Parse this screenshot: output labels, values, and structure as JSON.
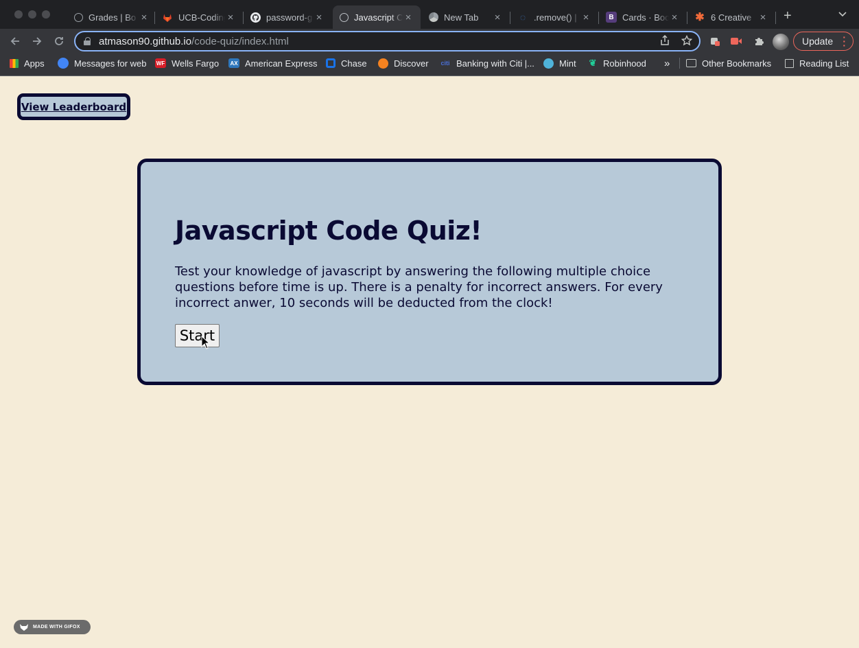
{
  "tabs": [
    {
      "title": "Grades | Bo",
      "icon": "globe-icon"
    },
    {
      "title": "UCB-Coding",
      "icon": "gitlab-icon"
    },
    {
      "title": "password-g",
      "icon": "github-icon"
    },
    {
      "title": "Javascript C",
      "icon": "globe-icon",
      "active": true
    },
    {
      "title": "New Tab",
      "icon": "chrome-icon"
    },
    {
      "title": ".remove() |",
      "icon": "jquery-icon"
    },
    {
      "title": "Cards · Boo",
      "icon": "bootstrap-icon"
    },
    {
      "title": "6 Creative",
      "icon": "asterisk-icon"
    }
  ],
  "tab_close_glyph": "×",
  "new_tab_glyph": "+",
  "address": {
    "host": "atmason90.github.io",
    "path": "/code-quiz/index.html"
  },
  "toolbar": {
    "update_label": "Update"
  },
  "bookmarks": [
    {
      "label": "Apps",
      "icon": "apps-grid-icon"
    },
    {
      "label": "Messages for web",
      "icon": "messages-icon"
    },
    {
      "label": "Wells Fargo",
      "icon": "wells-fargo-icon"
    },
    {
      "label": "American Express",
      "icon": "amex-icon"
    },
    {
      "label": "Chase",
      "icon": "chase-icon"
    },
    {
      "label": "Discover",
      "icon": "discover-icon"
    },
    {
      "label": "Banking with Citi |...",
      "icon": "citi-icon"
    },
    {
      "label": "Mint",
      "icon": "mint-icon"
    },
    {
      "label": "Robinhood",
      "icon": "robinhood-icon"
    },
    {
      "label": "Other Bookmarks",
      "icon": "folder-icon"
    },
    {
      "label": "Reading List",
      "icon": "reading-list-icon"
    }
  ],
  "bookmarks_overflow_glyph": "»",
  "page": {
    "leaderboard_link": "View Leaderboard",
    "title": "Javascript Code Quiz!",
    "description": "Test your knowledge of javascript by answering the following multiple choice questions before time is up. There is a penalty for incorrect answers. For every incorrect anwer, 10 seconds will be deducted from the clock!",
    "start_label": "Start"
  },
  "watermark": "MADE WITH GIFOX",
  "colors": {
    "page_bg": "#f5ecd8",
    "card_bg": "#b7c9d8",
    "navy": "#0a0a33"
  }
}
